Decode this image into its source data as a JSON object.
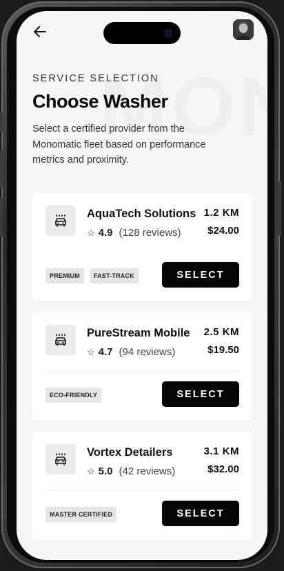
{
  "header": {
    "eyebrow": "SERVICE SELECTION",
    "title": "Choose Washer",
    "description": "Select a certified provider from the Monomatic fleet based on performance metrics and proximity."
  },
  "providers": [
    {
      "name": "AquaTech Solutions",
      "rating": "4.9",
      "reviews": "(128 reviews)",
      "distance": "1.2 KM",
      "price": "$24.00",
      "tags": [
        "PREMIUM",
        "FAST-TRACK"
      ],
      "select_label": "SELECT"
    },
    {
      "name": "PureStream Mobile",
      "rating": "4.7",
      "reviews": "(94 reviews)",
      "distance": "2.5 KM",
      "price": "$19.50",
      "tags": [
        "ECO-FRIENDLY"
      ],
      "select_label": "SELECT"
    },
    {
      "name": "Vortex Detailers",
      "rating": "5.0",
      "reviews": "(42 reviews)",
      "distance": "3.1 KM",
      "price": "$32.00",
      "tags": [
        "MASTER CERTIFIED"
      ],
      "select_label": "SELECT"
    }
  ],
  "icons": {
    "back": "arrow-left-icon",
    "provider": "car-wash-icon",
    "rating": "star-outline-icon"
  },
  "colors": {
    "accent": "#050505",
    "background": "#f6f6f6",
    "card": "#ffffff",
    "tag": "#e6e6e6"
  }
}
